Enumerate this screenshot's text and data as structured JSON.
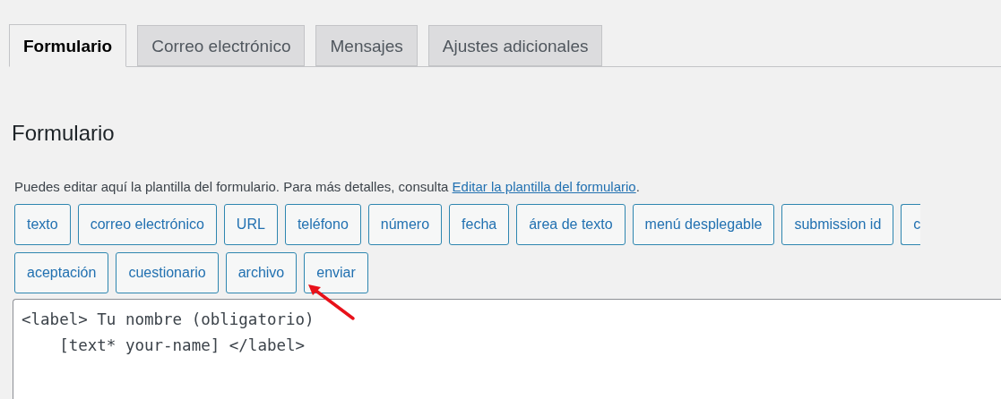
{
  "tabs": [
    {
      "label": "Formulario",
      "selected": true
    },
    {
      "label": "Correo electrónico",
      "selected": false
    },
    {
      "label": "Mensajes",
      "selected": false
    },
    {
      "label": "Ajustes adicionales",
      "selected": false
    }
  ],
  "panel": {
    "heading": "Formulario",
    "description_before": "Puedes editar aquí la plantilla del formulario. Para más detalles, consulta ",
    "description_link": "Editar la plantilla del formulario",
    "description_after": ".",
    "tag_buttons": [
      [
        "texto",
        "correo electrónico",
        "URL",
        "teléfono",
        "número",
        "fecha",
        "área de texto",
        "menú desplegable",
        "submission id",
        "c"
      ],
      [
        "aceptación",
        "cuestionario",
        "archivo",
        "enviar"
      ]
    ],
    "editor_lines": [
      "<label> Tu nombre (obligatorio)",
      "    [text* your-name] </label>"
    ]
  }
}
